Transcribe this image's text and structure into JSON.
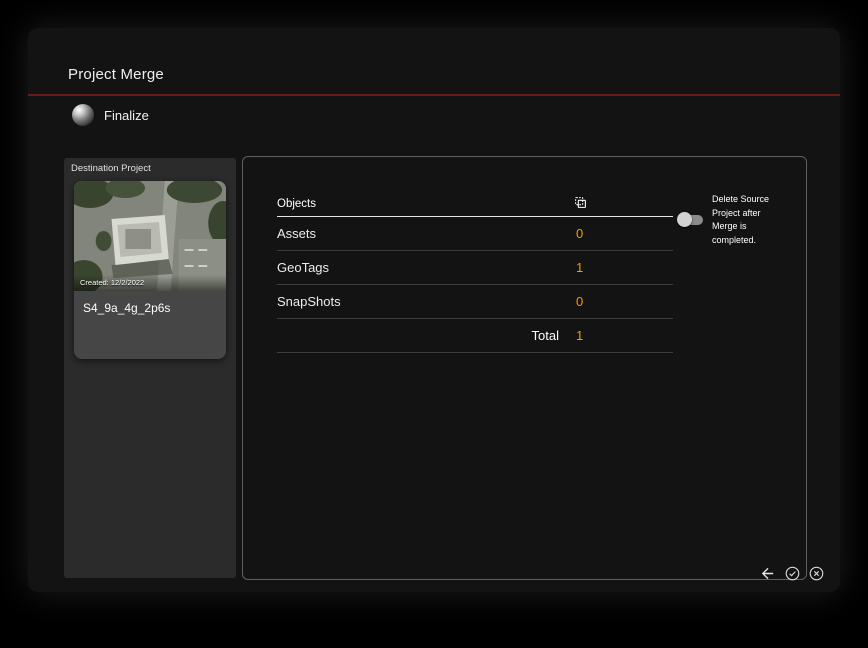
{
  "dialog": {
    "title": "Project Merge",
    "step": {
      "label": "Finalize"
    }
  },
  "destination": {
    "section_label": "Destination Project",
    "created": "Created: 12/2/2022",
    "name": "S4_9a_4g_2p6s"
  },
  "table": {
    "header": "Objects",
    "rows": [
      {
        "label": "Assets",
        "value": "0"
      },
      {
        "label": "GeoTags",
        "value": "1"
      },
      {
        "label": "SnapShots",
        "value": "0"
      }
    ],
    "total": {
      "label": "Total",
      "value": "1"
    }
  },
  "options": {
    "delete_source_label": "Delete Source Project after Merge is completed.",
    "delete_source_enabled": false
  },
  "footer": {
    "icons": [
      "back-arrow-icon",
      "confirm-icon",
      "close-icon"
    ]
  },
  "colors": {
    "accent": "#f59b00",
    "divider_red": "#641c1c"
  }
}
